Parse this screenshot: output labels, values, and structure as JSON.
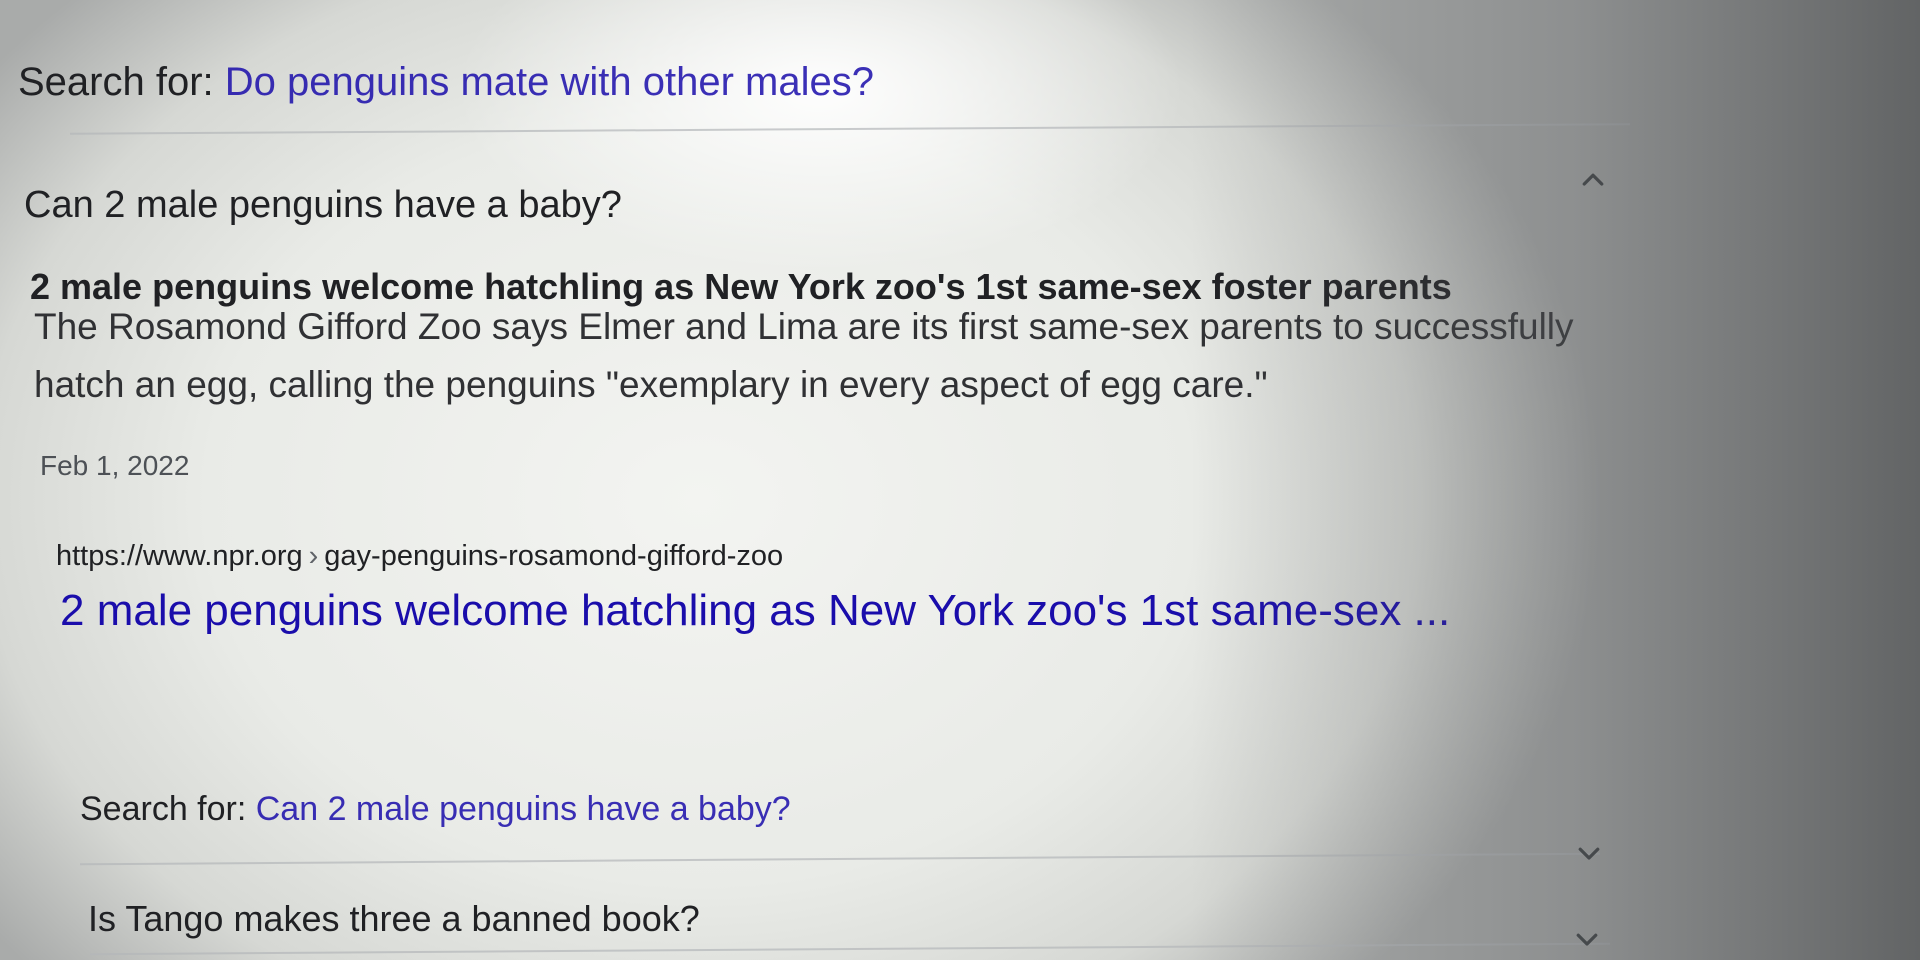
{
  "search_top": {
    "label": "Search for: ",
    "query": "Do penguins mate with other males?"
  },
  "faq": [
    {
      "question": "Can 2 male penguins have a baby?",
      "expanded": true,
      "chevron": "chevron-up-icon",
      "answer_title": "2 male penguins welcome hatchling as New York zoo's 1st same-sex foster parents",
      "snippet": "The Rosamond Gifford Zoo says Elmer and Lima are its first same-sex parents to successfully hatch an egg, calling the penguins \"exemplary in every aspect of egg care.\"",
      "date": "Feb 1, 2022",
      "url_domain": "https://www.npr.org",
      "url_separator": "›",
      "url_path": "gay-penguins-rosamond-gifford-zoo",
      "result_title": "2 male penguins welcome hatchling as New York zoo's 1st same-sex ...",
      "search_label": "Search for: ",
      "search_query": "Can 2 male penguins have a baby?"
    },
    {
      "question": "Is Tango makes three a banned book?",
      "expanded": false,
      "chevron": "chevron-down-icon"
    }
  ],
  "colors": {
    "link": "#1a0dab",
    "text": "#202124"
  }
}
